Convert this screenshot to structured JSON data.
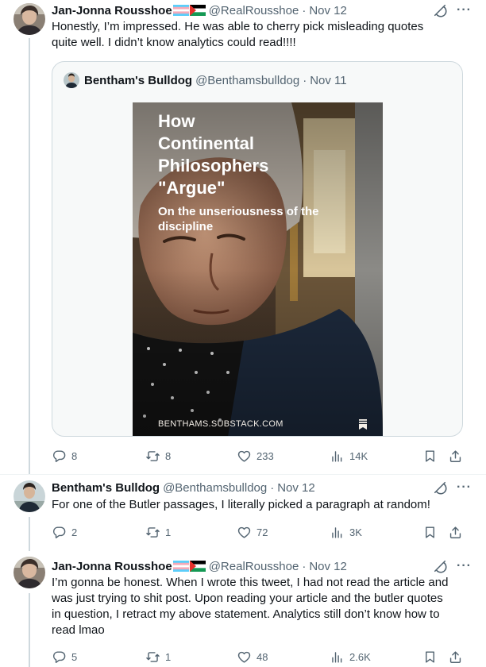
{
  "tweets": [
    {
      "author_name": "Jan-Jonna Rousshoe",
      "handle": "@RealRousshoe",
      "separator": "·",
      "date": "Nov 12",
      "text_lines": [
        "Honestly, I’m impressed. He was able to cherry pick misleading quotes",
        "quite well. I didn’t know analytics could read!!!!"
      ],
      "quote": {
        "author_name": "Bentham's Bulldog",
        "handle": "@Benthamsbulldog",
        "separator": "·",
        "date": "Nov 11",
        "cover": {
          "title_lines": [
            "How",
            "Continental",
            "Philosophers",
            "\"Argue\""
          ],
          "subtitle_lines": [
            "On the unseriousness of the",
            "discipline"
          ],
          "site": "BENTHAMS.SUBSTACK.COM"
        }
      },
      "stats": {
        "replies": "8",
        "reposts": "8",
        "likes": "233",
        "views": "14K"
      }
    },
    {
      "author_name": "Bentham's Bulldog",
      "handle": "@Benthamsbulldog",
      "separator": "·",
      "date": "Nov 12",
      "text_lines": [
        "For one of the Butler passages, I literally picked a paragraph at random!"
      ],
      "stats": {
        "replies": "2",
        "reposts": "1",
        "likes": "72",
        "views": "3K"
      }
    },
    {
      "author_name": "Jan-Jonna Rousshoe",
      "handle": "@RealRousshoe",
      "separator": "·",
      "date": "Nov 12",
      "text_lines": [
        "I’m gonna be honest. When I wrote this tweet, I had not read the article and",
        "was just trying to shit post. Upon reading your article and the butler quotes",
        "in question, I retract my above statement. Analytics still don’t know how to",
        "read lmao"
      ],
      "stats": {
        "replies": "5",
        "reposts": "1",
        "likes": "48",
        "views": "2.6K"
      }
    }
  ],
  "icons": {
    "flags": [
      "transgender-flag-icon",
      "palestine-flag-icon"
    ],
    "header": [
      "grok-icon",
      "more-icon"
    ],
    "actions": [
      "reply-icon",
      "repost-icon",
      "like-icon",
      "views-icon",
      "bookmark-icon",
      "share-icon"
    ]
  },
  "colors": {
    "text": "#0f1419",
    "secondary": "#536471",
    "border": "#cfd9de",
    "quote_bg": "#f7f9f9",
    "trans_blue": "#5bcefa",
    "trans_pink": "#f5a9b8",
    "palestine_red": "#e4312b",
    "palestine_green": "#149954"
  }
}
